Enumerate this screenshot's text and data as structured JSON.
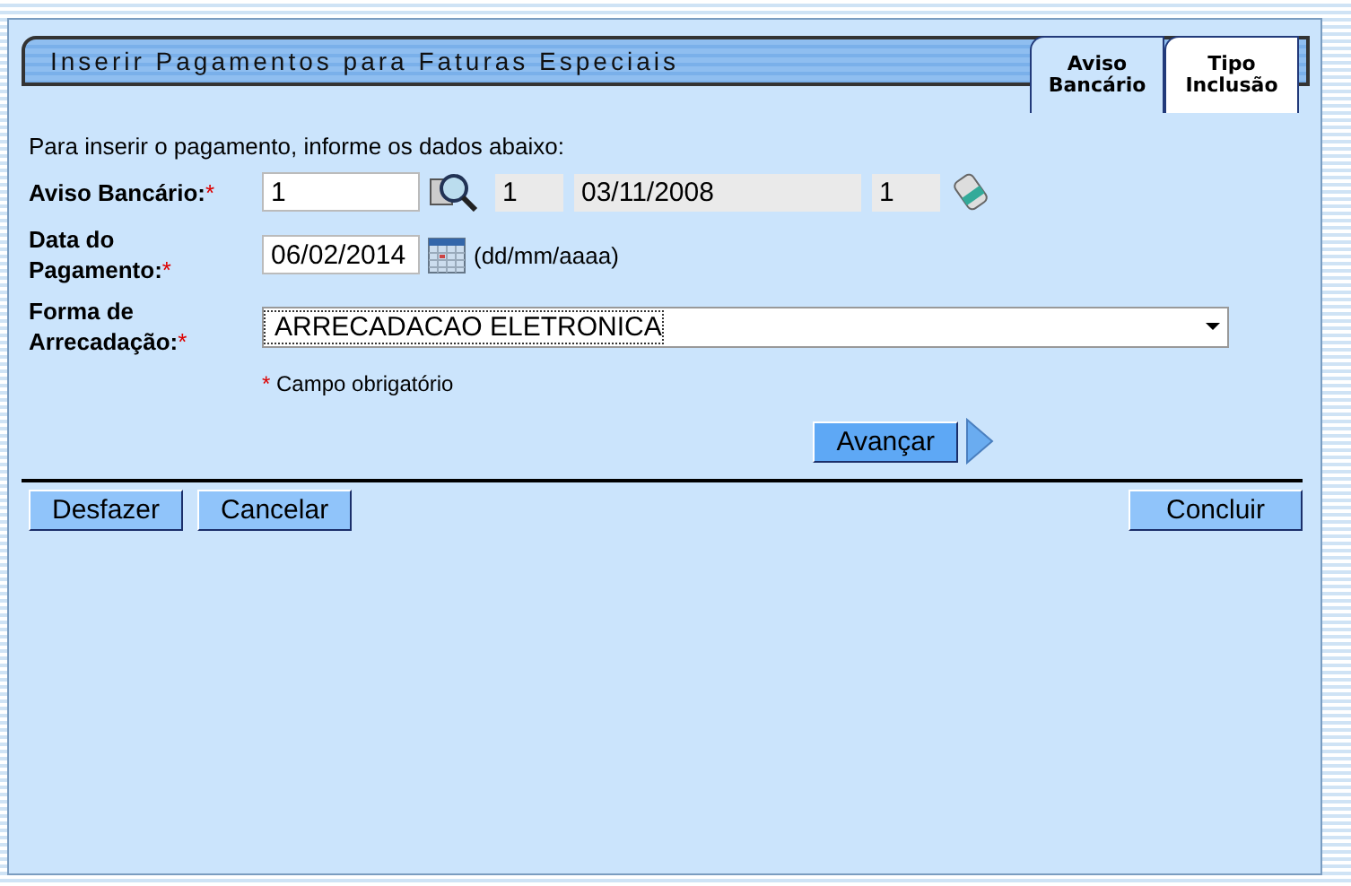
{
  "window": {
    "title": "Inserir Pagamentos para Faturas Especiais"
  },
  "tabs": [
    {
      "label": "Aviso Bancário",
      "selected": true
    },
    {
      "label": "Tipo Inclusão",
      "selected": false
    }
  ],
  "instructions": "Para inserir o pagamento, informe os dados abaixo:",
  "aviso_bancario": {
    "label": "Aviso Bancário:",
    "required": true,
    "value": "1",
    "info": [
      "1",
      "03/11/2008",
      "1"
    ]
  },
  "data_pagamento": {
    "label": "Data do Pagamento:",
    "required": true,
    "value": "06/02/2014",
    "hint": "(dd/mm/aaaa)"
  },
  "forma_arrecadacao": {
    "label": "Forma de Arrecadação:",
    "required": true,
    "value": "ARRECADACAO ELETRONICA"
  },
  "required_note": {
    "mark": "*",
    "text": "Campo obrigatório"
  },
  "next_button": "Avançar",
  "left_buttons": [
    "Desfazer",
    "Cancelar"
  ],
  "right_buttons": [
    "Concluir"
  ]
}
